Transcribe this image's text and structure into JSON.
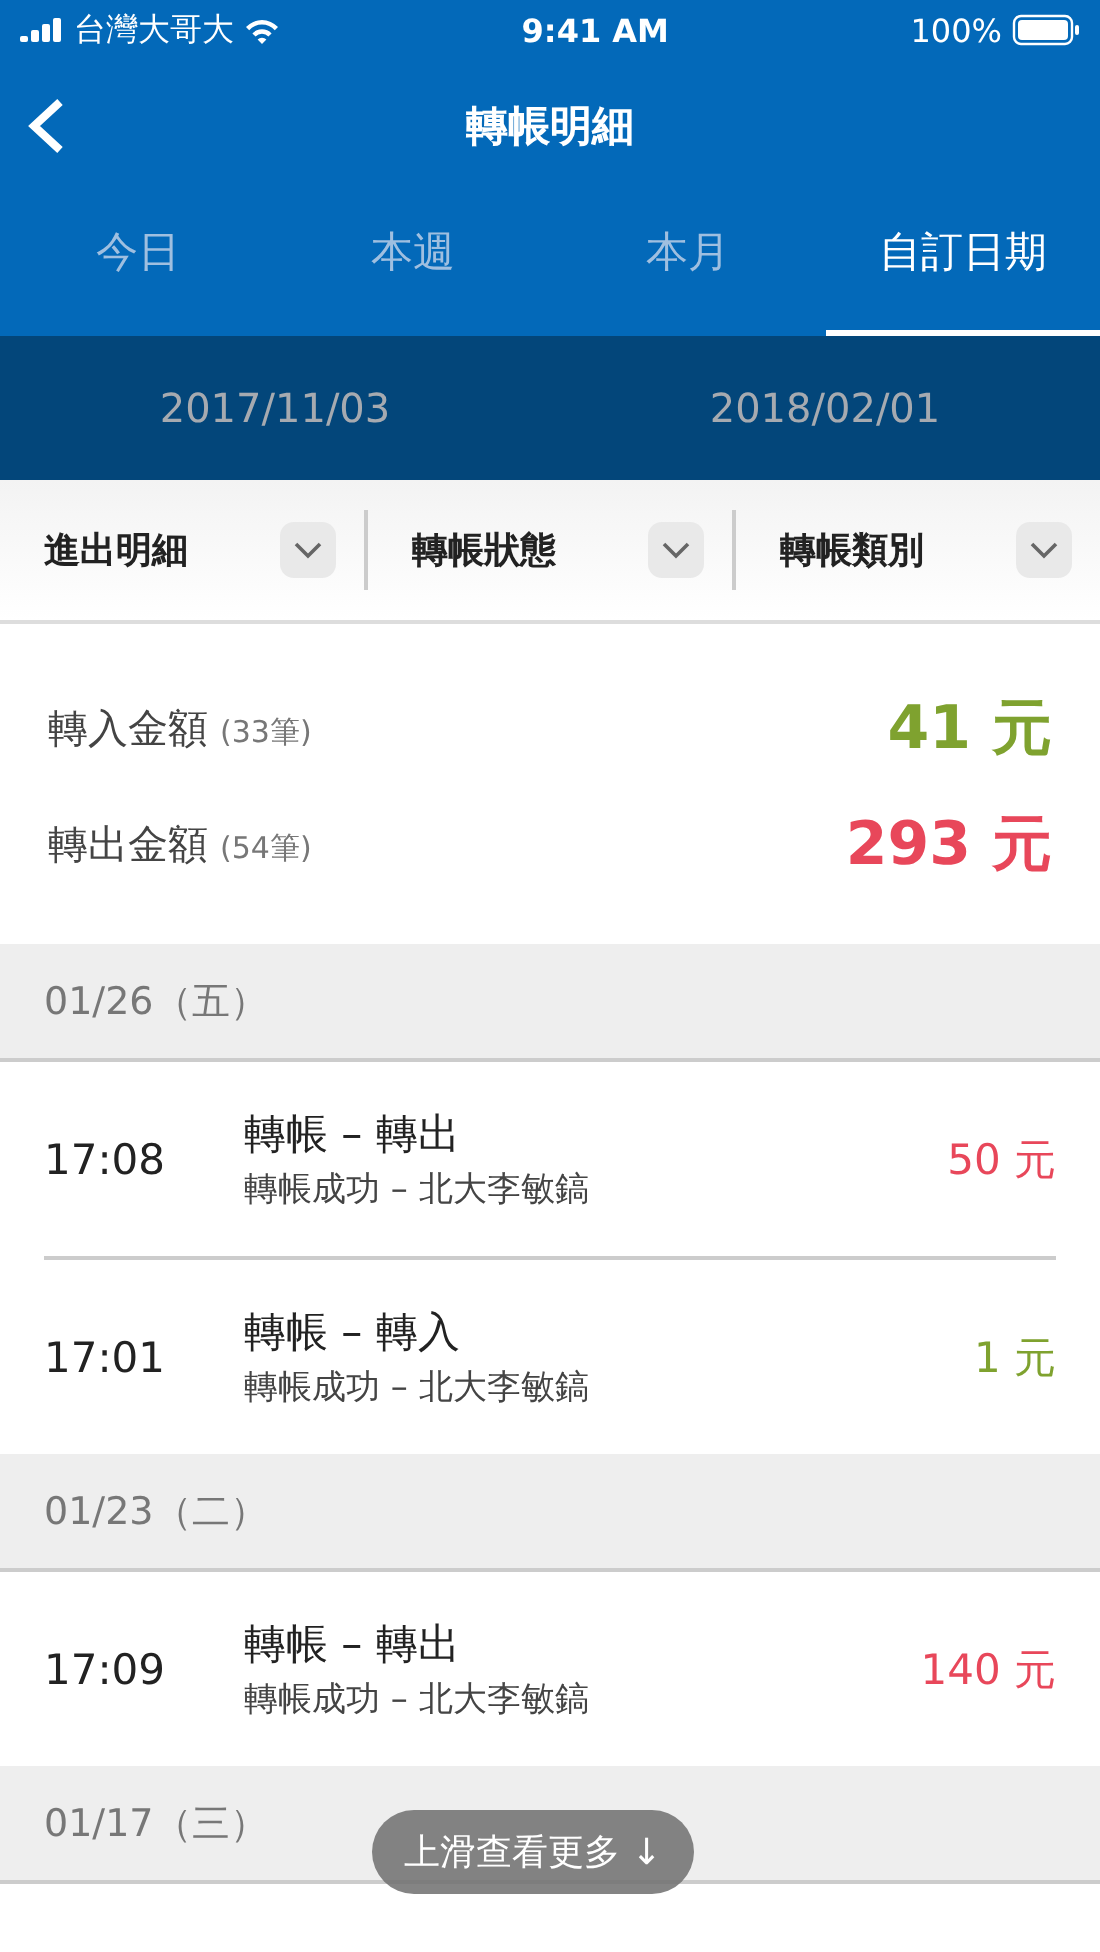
{
  "status_bar": {
    "carrier": "台灣大哥大",
    "time": "9:41 AM",
    "battery": "100%"
  },
  "nav": {
    "title": "轉帳明細"
  },
  "tabs": [
    {
      "label": "今日",
      "selected": false
    },
    {
      "label": "本週",
      "selected": false
    },
    {
      "label": "本月",
      "selected": false
    },
    {
      "label": "自訂日期",
      "selected": true
    }
  ],
  "date_range": {
    "start": "2017/11/03",
    "end": "2018/02/01"
  },
  "filters": [
    {
      "label": "進出明細"
    },
    {
      "label": "轉帳狀態"
    },
    {
      "label": "轉帳類別"
    }
  ],
  "summary": [
    {
      "kind": "in",
      "label": "轉入金額",
      "count": "(33筆)",
      "amount": "41 元"
    },
    {
      "kind": "out",
      "label": "轉出金額",
      "count": "(54筆)",
      "amount": "293 元"
    }
  ],
  "groups": [
    {
      "date": "01/26（五）",
      "transactions": [
        {
          "time": "17:08",
          "title": "轉帳 – 轉出",
          "detail": "轉帳成功 – 北大李敏鎬",
          "amount": "50 元",
          "kind": "out"
        },
        {
          "time": "17:01",
          "title": "轉帳 – 轉入",
          "detail": "轉帳成功 – 北大李敏鎬",
          "amount": "1 元",
          "kind": "in"
        }
      ]
    },
    {
      "date": "01/23（二）",
      "transactions": [
        {
          "time": "17:09",
          "title": "轉帳 – 轉出",
          "detail": "轉帳成功 – 北大李敏鎬",
          "amount": "140 元",
          "kind": "out"
        }
      ]
    },
    {
      "date": "01/17（三）"
    }
  ],
  "scroll_hint": {
    "label": "上滑查看更多 ↓"
  }
}
